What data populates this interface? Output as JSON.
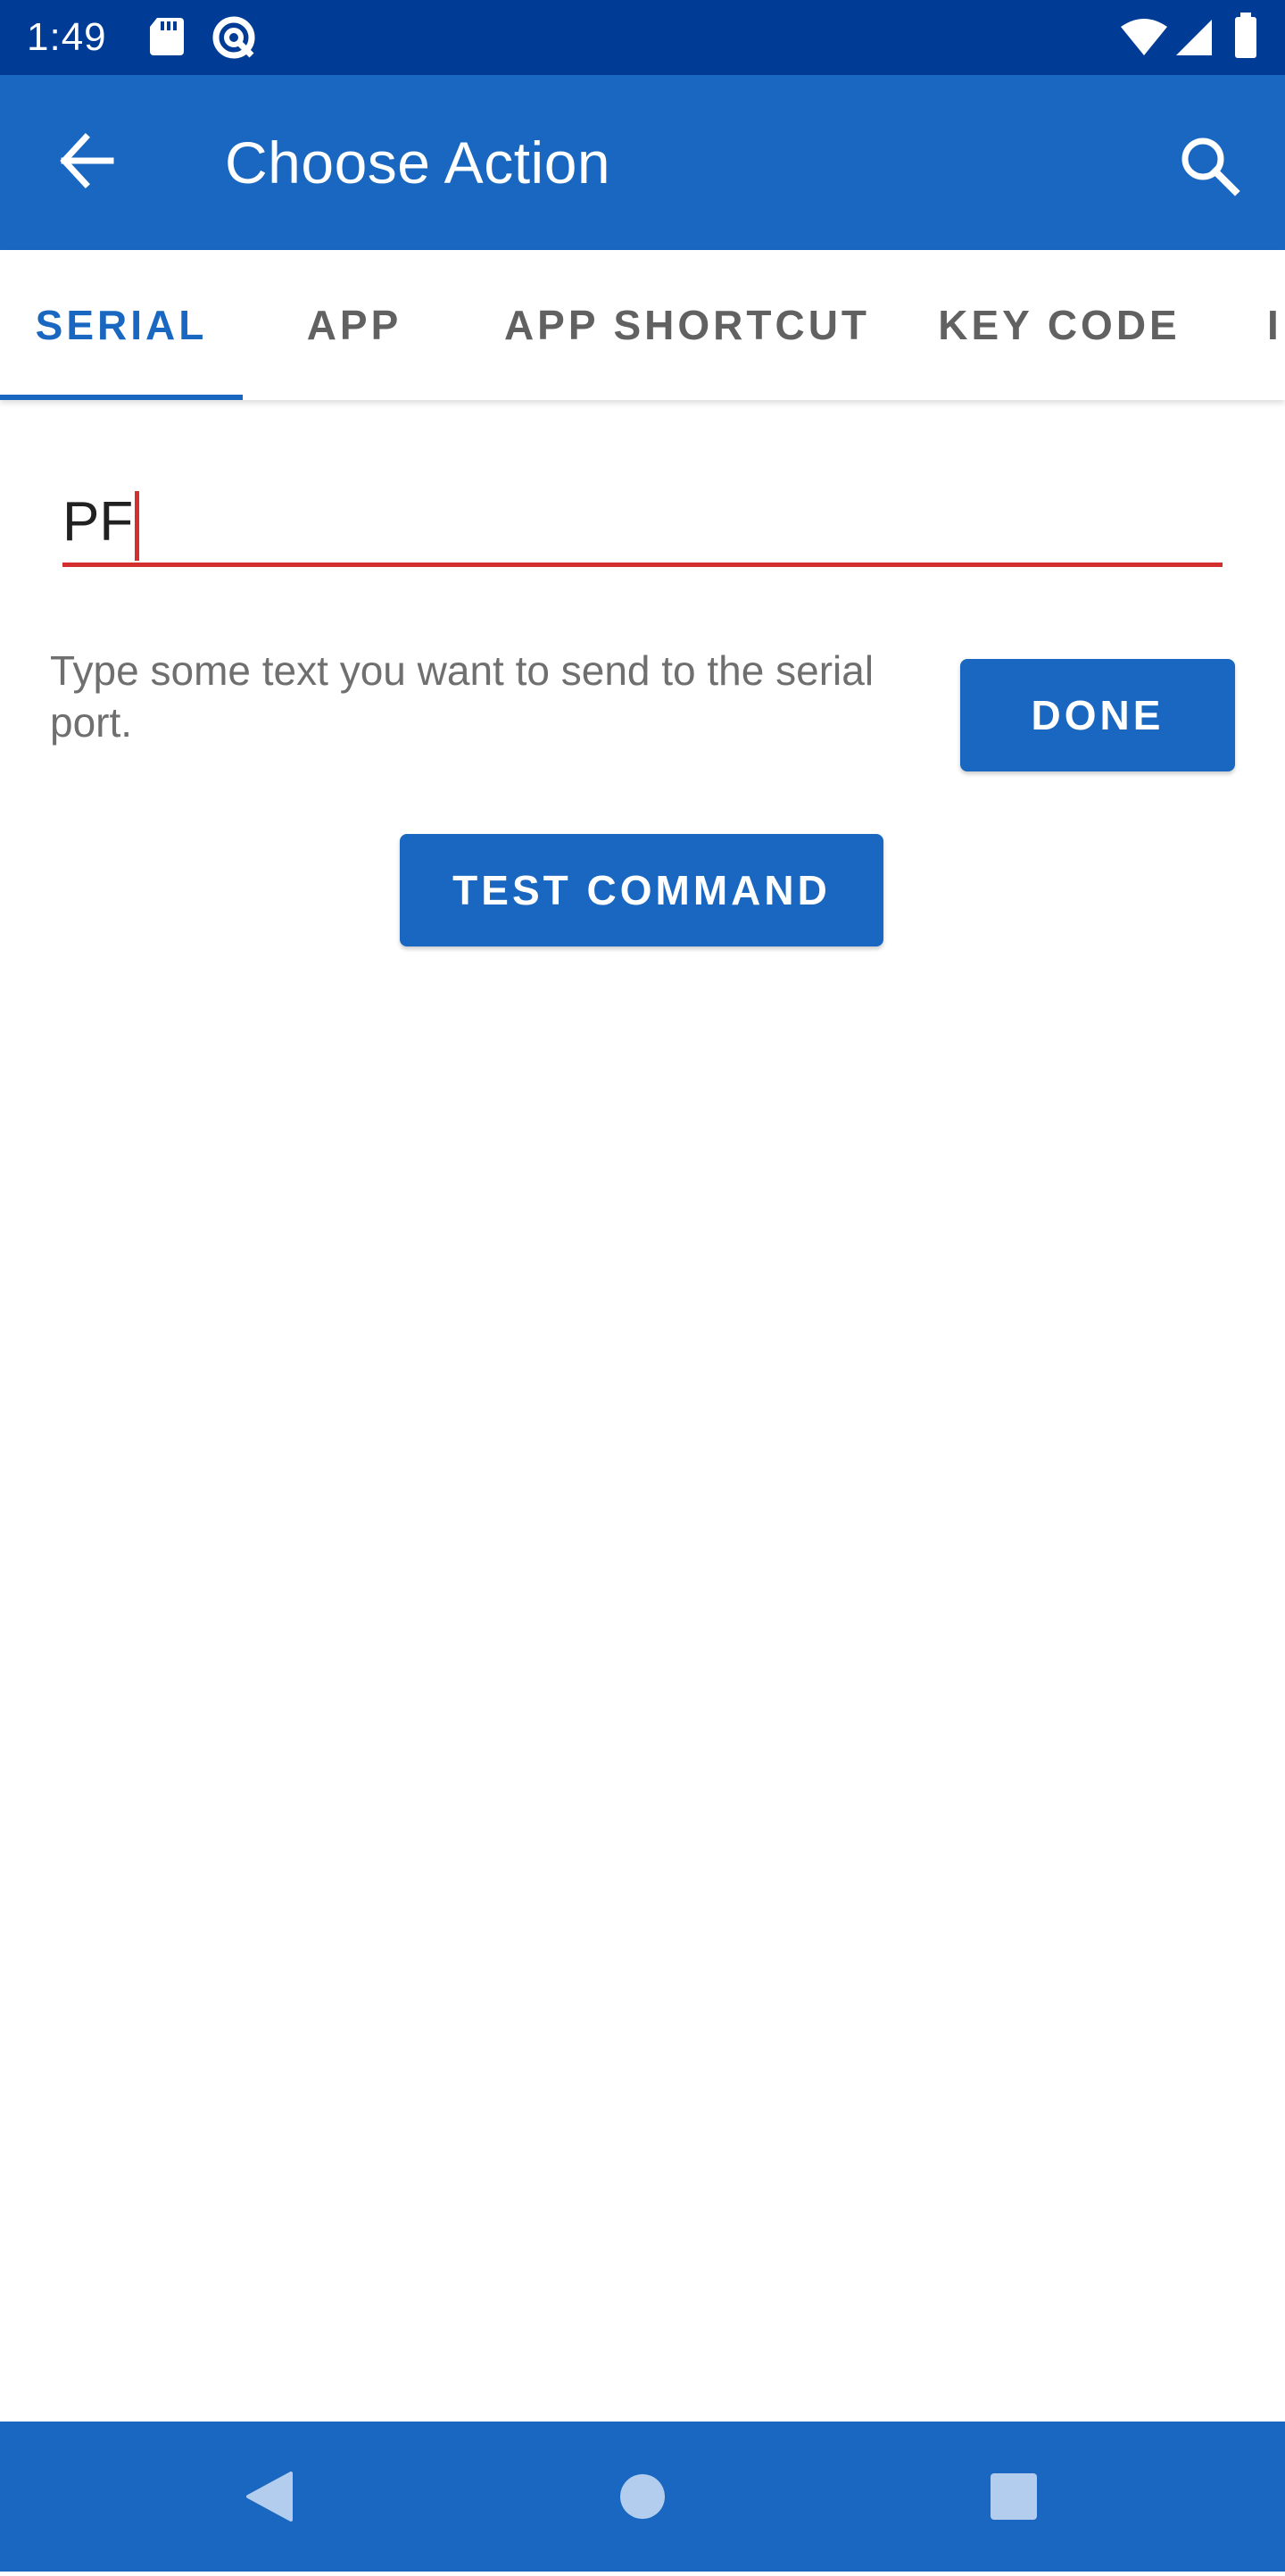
{
  "status_bar": {
    "time": "1:49",
    "left_icons": [
      "sd-card-icon",
      "data-saver-icon"
    ],
    "right_icons": [
      "wifi-icon",
      "signal-icon",
      "battery-icon"
    ]
  },
  "app_bar": {
    "title": "Choose Action",
    "back_icon": "arrow-left-icon",
    "search_icon": "search-icon",
    "color": "#1967c0"
  },
  "tabs": [
    {
      "label": "SERIAL",
      "active": true
    },
    {
      "label": "APP",
      "active": false
    },
    {
      "label": "APP SHORTCUT",
      "active": false
    },
    {
      "label": "KEY CODE",
      "active": false
    },
    {
      "label": "I",
      "active": false
    }
  ],
  "serial": {
    "input_value": "PF",
    "underline_color": "#d32f2f",
    "helper_text": "Type some text you want to send to the serial port.",
    "done_label": "DONE",
    "test_label": "TEST COMMAND"
  },
  "nav_bar": {
    "icons": [
      "back-triangle-icon",
      "home-circle-icon",
      "recents-square-icon"
    ]
  },
  "colors": {
    "status_bar": "#003c96",
    "primary": "#1967c0",
    "error": "#d32f2f"
  }
}
